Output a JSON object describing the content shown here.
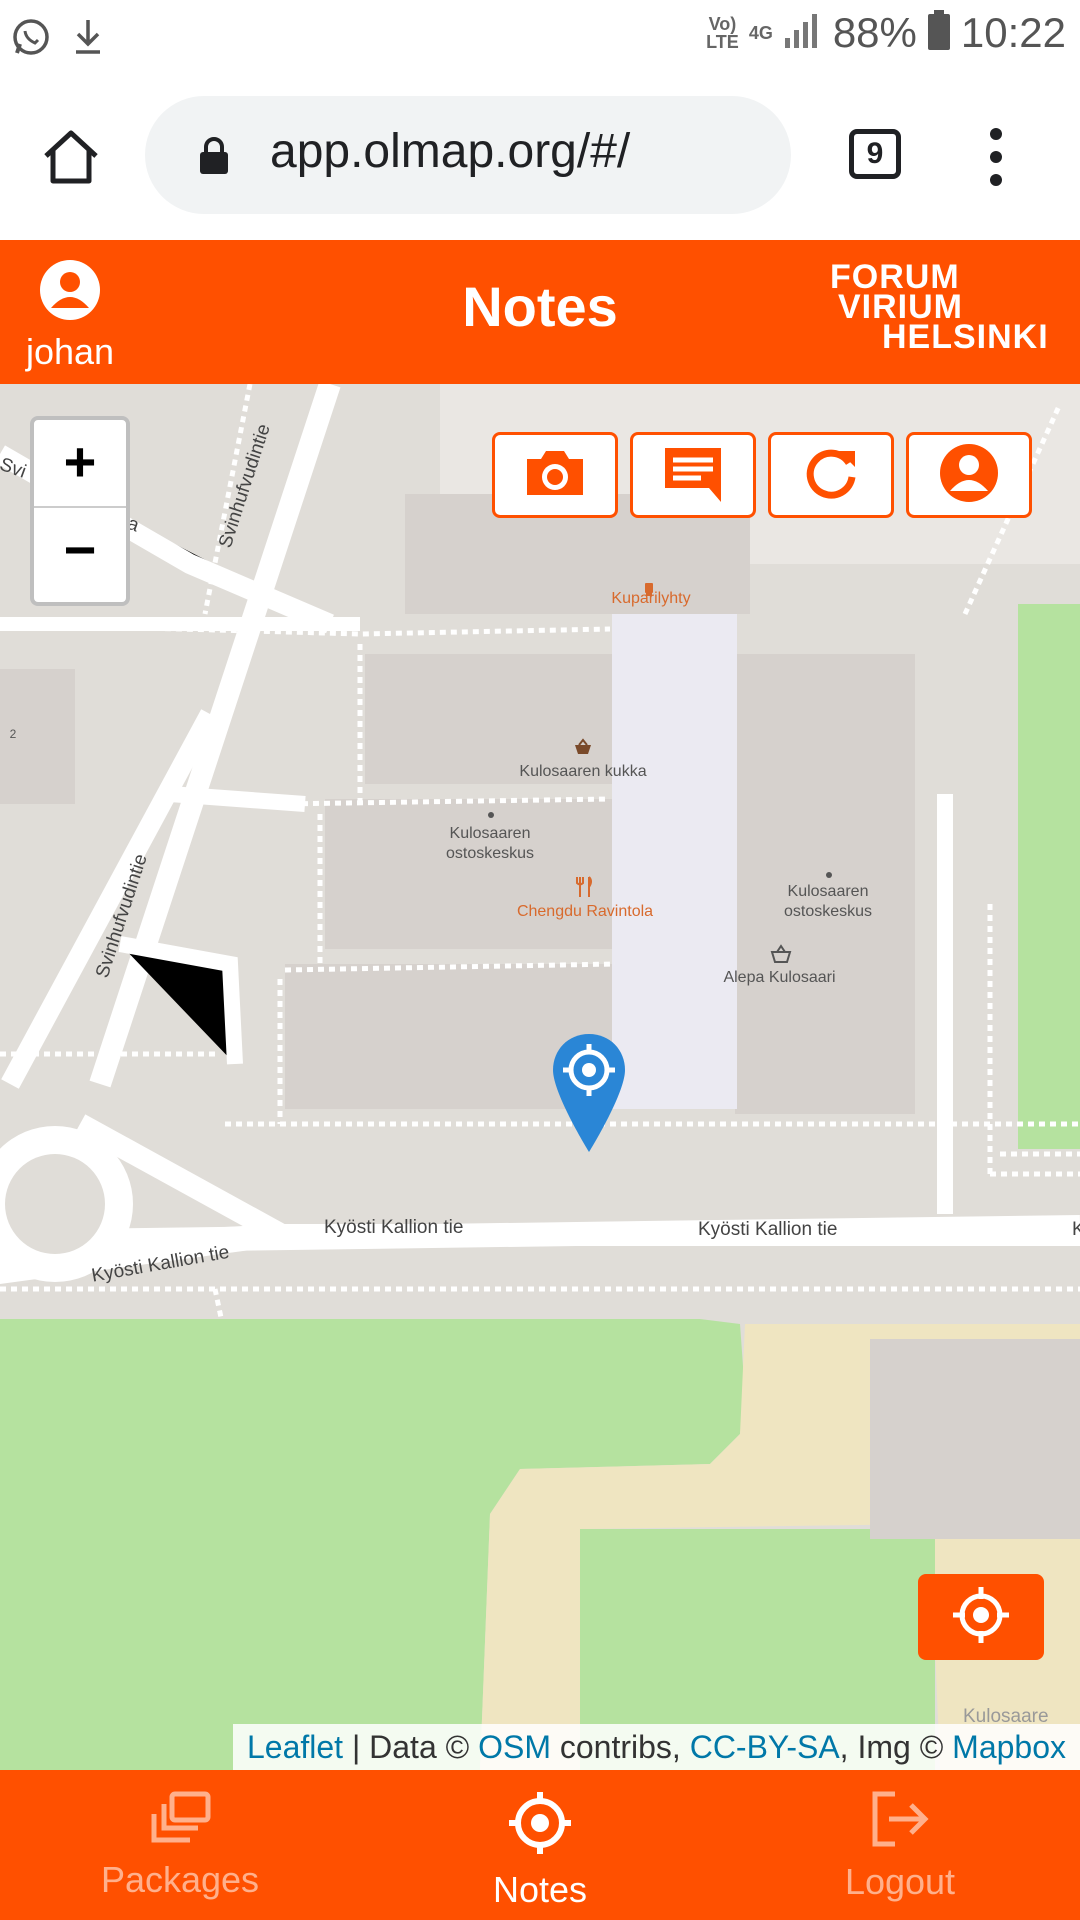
{
  "status_bar": {
    "network_top": "Vo)",
    "network_bottom": "LTE",
    "signal_type": "4G",
    "battery": "88%",
    "time": "10:22",
    "icons": [
      "whatsapp-icon",
      "download-icon",
      "signal-icon",
      "battery-icon"
    ]
  },
  "browser": {
    "url": "app.olmap.org/#/",
    "tab_count": "9"
  },
  "app_header": {
    "user_name": "johan",
    "title": "Notes",
    "brand_line1": "FORUM",
    "brand_line2": "VIRIUM",
    "brand_line3": "HELSINKI"
  },
  "map": {
    "zoom_in": "+",
    "zoom_out": "−",
    "toolbar_icons": [
      "camera-icon",
      "comment-icon",
      "refresh-icon",
      "user-icon"
    ],
    "places": [
      "Kuparilyhty",
      "Kulosaaren kukka",
      "Kulosaaren ostoskeskus",
      "Chengdu Ravintola",
      "Kulosaaren ostoskeskus",
      "Alepa Kulosaari"
    ],
    "roads": [
      "Svinhufvudintie",
      "Svinhufvudintie",
      "Kyösti Kallion tie",
      "Kyösti Kallion tie",
      "Kyösti Kallion tie"
    ],
    "edge_labels": [
      "Svi",
      "uja",
      "2",
      "K",
      "Kulosaare"
    ],
    "attribution": {
      "leaflet": "Leaflet",
      "sep1": " | Data © ",
      "osm": "OSM",
      "sep2": " contribs, ",
      "license": "CC-BY-SA",
      "sep3": ", Img © ",
      "mapbox": "Mapbox"
    }
  },
  "bottom_nav": {
    "packages": "Packages",
    "notes": "Notes",
    "logout": "Logout"
  },
  "colors": {
    "accent": "#ff5000",
    "marker": "#2a86d6",
    "park": "#b5e29f",
    "sand": "#efe5c1"
  }
}
